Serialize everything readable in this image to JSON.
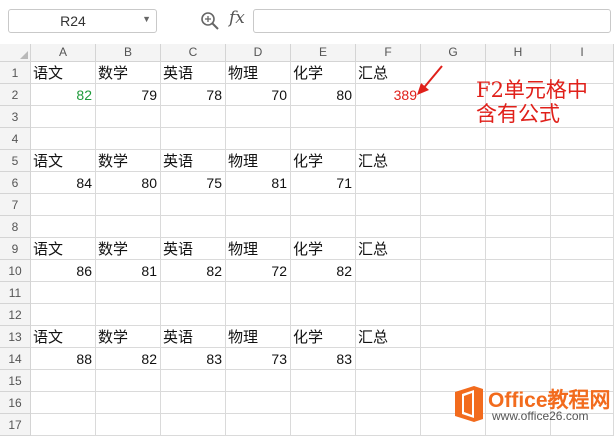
{
  "formula_bar": {
    "name_box_value": "R24",
    "dropdown_icon": "chevron-down-icon",
    "zoom_icon": "magnifier-icon",
    "fx_label": "fx",
    "formula_value": ""
  },
  "columns": [
    "A",
    "B",
    "C",
    "D",
    "E",
    "F",
    "G",
    "H",
    "I"
  ],
  "rows": [
    "1",
    "2",
    "3",
    "4",
    "5",
    "6",
    "7",
    "8",
    "9",
    "10",
    "11",
    "12",
    "13",
    "14",
    "15",
    "16",
    "17"
  ],
  "cells": {
    "A1": "语文",
    "B1": "数学",
    "C1": "英语",
    "D1": "物理",
    "E1": "化学",
    "F1": "汇总",
    "A2": "82",
    "B2": "79",
    "C2": "78",
    "D2": "70",
    "E2": "80",
    "F2": "389",
    "A5": "语文",
    "B5": "数学",
    "C5": "英语",
    "D5": "物理",
    "E5": "化学",
    "F5": "汇总",
    "A6": "84",
    "B6": "80",
    "C6": "75",
    "D6": "81",
    "E6": "71",
    "A9": "语文",
    "B9": "数学",
    "C9": "英语",
    "D9": "物理",
    "E9": "化学",
    "F9": "汇总",
    "A10": "86",
    "B10": "81",
    "C10": "82",
    "D10": "72",
    "E10": "82",
    "A13": "语文",
    "B13": "数学",
    "C13": "英语",
    "D13": "物理",
    "E13": "化学",
    "F13": "汇总",
    "A14": "88",
    "B14": "82",
    "C14": "83",
    "D14": "73",
    "E14": "83"
  },
  "cell_colors": {
    "A2": "#1e9a3a",
    "F2": "#e0201a"
  },
  "annotation": {
    "line1": "F2单元格中",
    "line2": "含有公式",
    "color": "#e0201a"
  },
  "watermark": {
    "title": "Office教程网",
    "url": "www.office26.com",
    "brand_color": "#f26b1d"
  }
}
